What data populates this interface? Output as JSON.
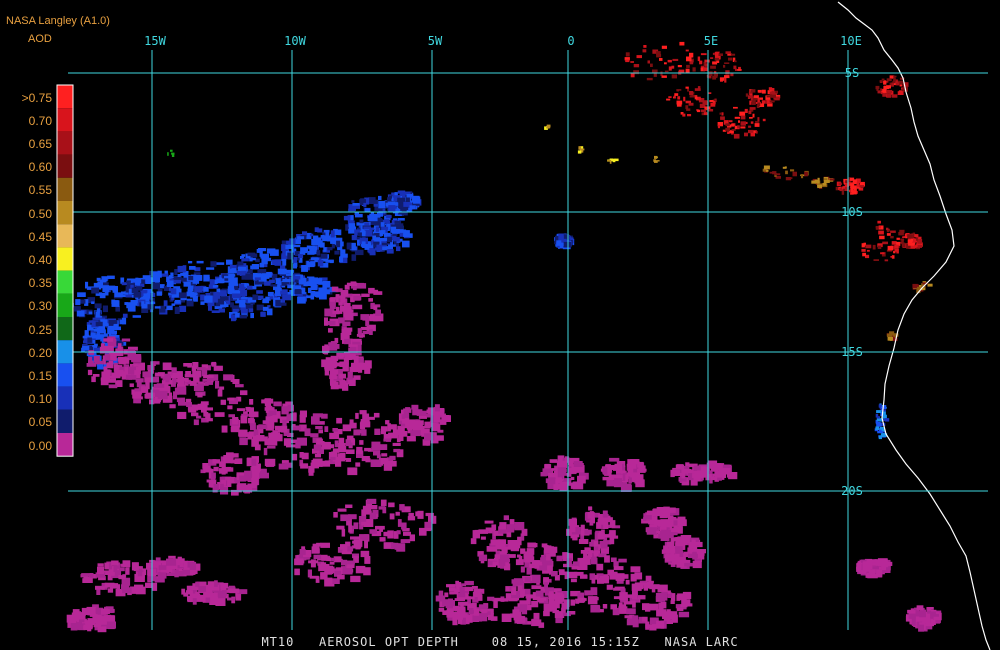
{
  "header": {
    "source": "NASA Langley (A1.0)",
    "product": "AOD"
  },
  "color_scale": [
    {
      "label": ">0.75",
      "color": "#ff2020"
    },
    {
      "label": "0.70",
      "color": "#d8141c"
    },
    {
      "label": "0.65",
      "color": "#a81018"
    },
    {
      "label": "0.60",
      "color": "#7a0e10"
    },
    {
      "label": "0.55",
      "color": "#8a5a10"
    },
    {
      "label": "0.50",
      "color": "#b88a20"
    },
    {
      "label": "0.45",
      "color": "#e8b858"
    },
    {
      "label": "0.40",
      "color": "#f8f020"
    },
    {
      "label": "0.35",
      "color": "#38d838"
    },
    {
      "label": "0.30",
      "color": "#18a818"
    },
    {
      "label": "0.25",
      "color": "#106818"
    },
    {
      "label": "0.20",
      "color": "#1890e8"
    },
    {
      "label": "0.15",
      "color": "#1850f0"
    },
    {
      "label": "0.10",
      "color": "#1830b8"
    },
    {
      "label": "0.05",
      "color": "#101c6c"
    },
    {
      "label": "0.00",
      "color": "#b82898"
    }
  ],
  "grid": {
    "longitudes": [
      "15W",
      "10W",
      "5W",
      "0",
      "5E",
      "10E"
    ],
    "latitudes": [
      "5S",
      "10S",
      "15S",
      "20S"
    ],
    "line_color": "#40d8e0"
  },
  "footer": {
    "product": "MT10",
    "title": "AEROSOL OPT DEPTH",
    "date": "08 15, 2016",
    "time": "15:15Z",
    "credit": "NASA LARC"
  }
}
